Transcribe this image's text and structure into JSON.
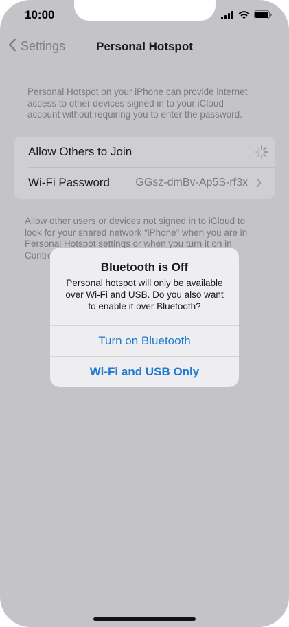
{
  "status_bar": {
    "time": "10:00"
  },
  "nav": {
    "back_label": "Settings",
    "title": "Personal Hotspot"
  },
  "hotspot": {
    "intro_lines": [
      "Personal Hotspot on your iPhone can provide internet",
      "access to other devices signed in to your iCloud",
      "account without requiring you to enter the password."
    ],
    "allow_label": "Allow Others to Join",
    "wifi_label": "Wi-Fi Password",
    "wifi_value": "GGsz-dmBv-Ap5S-rf3x",
    "footer_lines": [
      "Allow other users or devices not signed in to iCloud to",
      "look for your shared network “iPhone” when you are in",
      "Personal Hotspot settings or when you turn it on in",
      "Contro"
    ]
  },
  "alert": {
    "title": "Bluetooth is Off",
    "message_lines": [
      "Personal hotspot will only be available",
      "over Wi-Fi and USB. Do you also want",
      "to enable it over Bluetooth?"
    ],
    "primary_button": "Turn on Bluetooth",
    "secondary_button": "Wi-Fi and USB Only"
  },
  "colors": {
    "background": "#c4c3c8",
    "alert_background": "#eeeef0",
    "accent": "#1f7ad3"
  }
}
